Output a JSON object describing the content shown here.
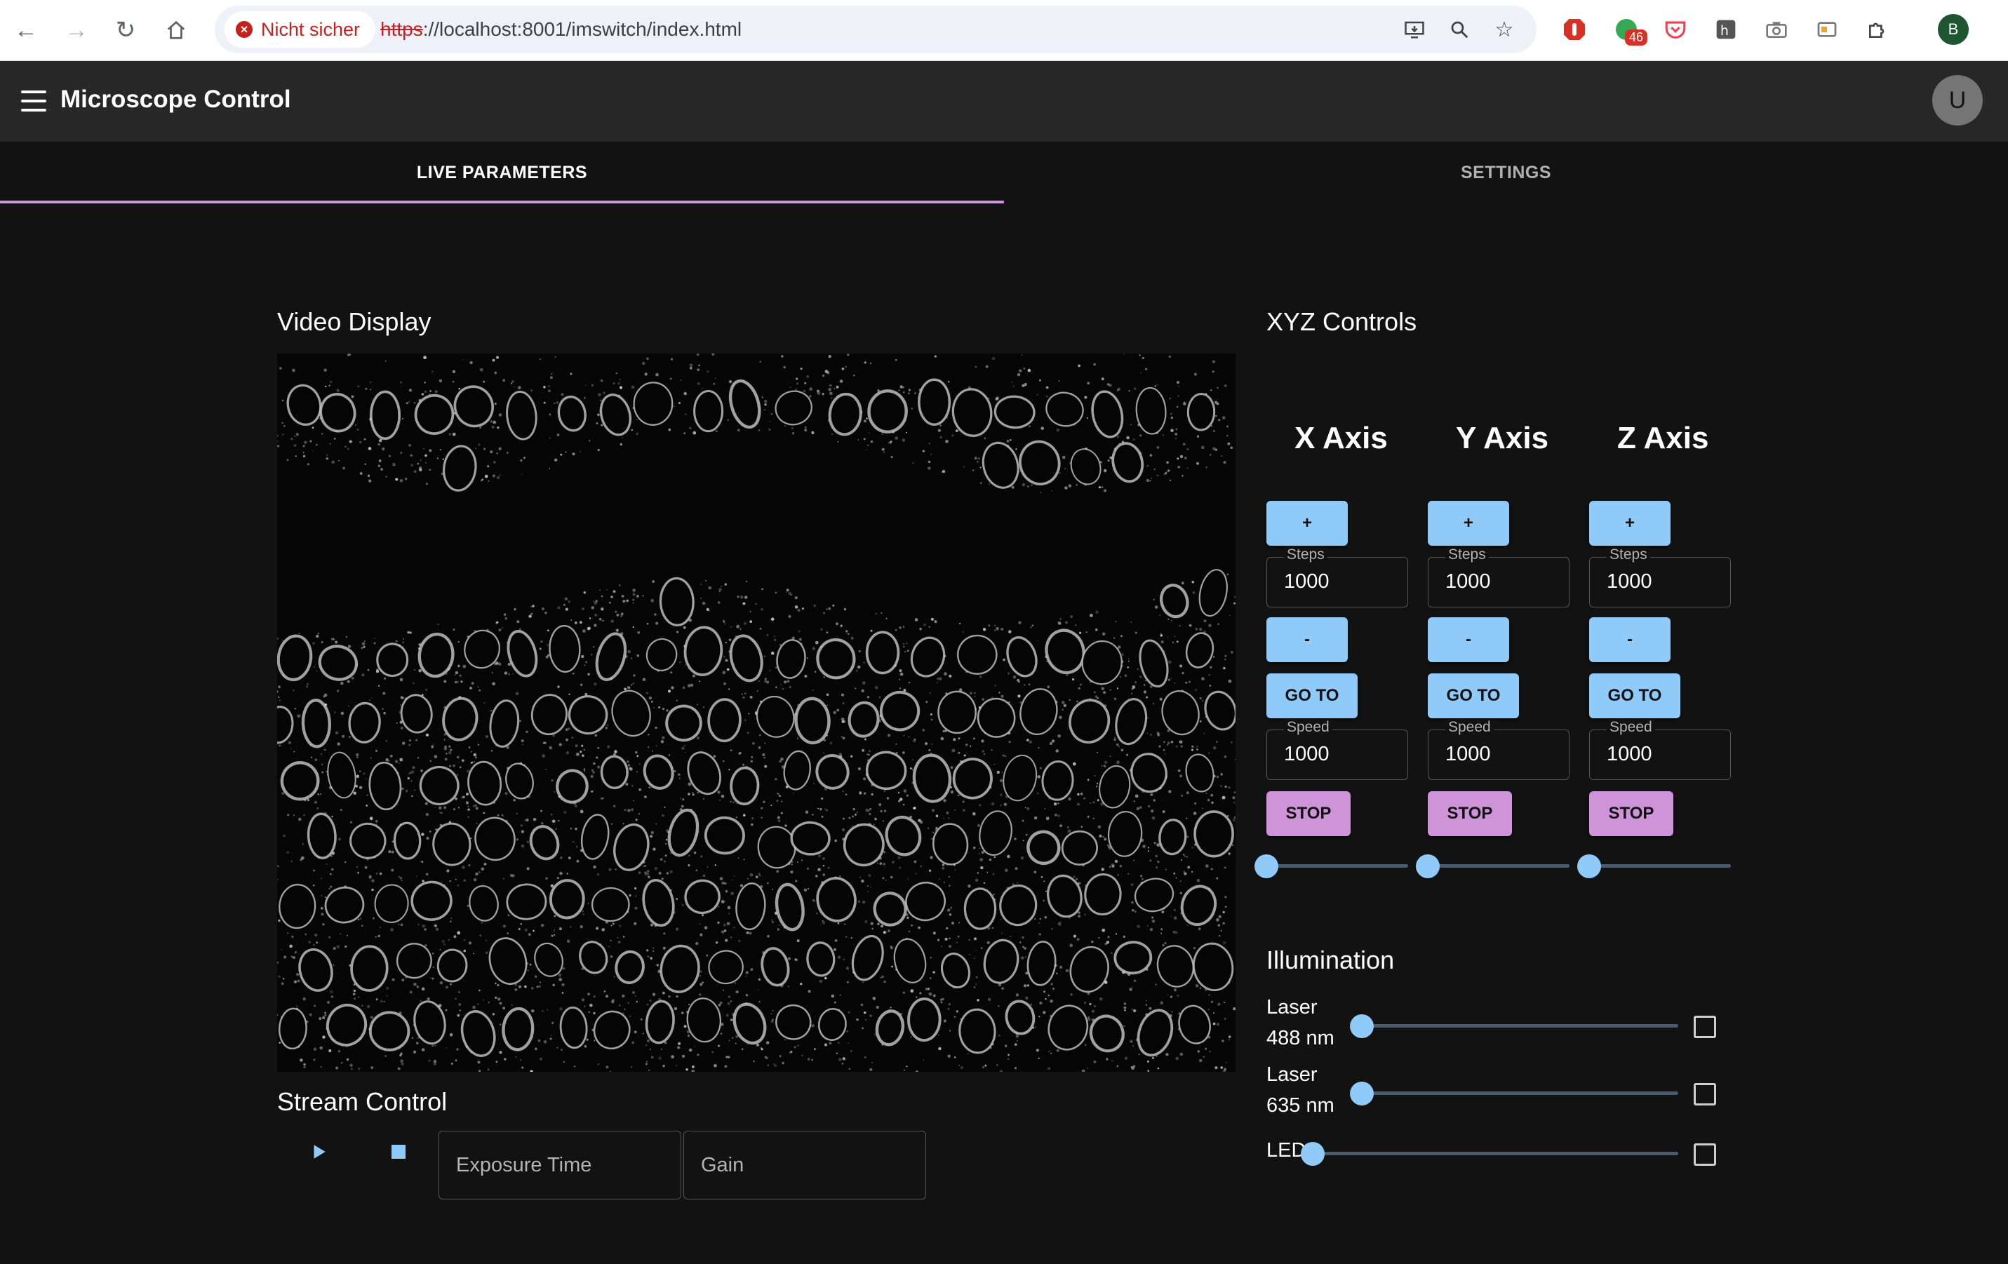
{
  "browser": {
    "security_label": "Nicht sicher",
    "url_protocol": "https",
    "url_rest": "://localhost:8001/imswitch/index.html",
    "extension_badge": "46",
    "profile_initial": "B"
  },
  "appbar": {
    "title": "Microscope Control",
    "avatar_initial": "U"
  },
  "tabs": [
    {
      "label": "LIVE PARAMETERS",
      "active": true
    },
    {
      "label": "SETTINGS",
      "active": false
    }
  ],
  "video": {
    "title": "Video Display"
  },
  "stream": {
    "title": "Stream Control",
    "exposure_placeholder": "Exposure Time",
    "gain_placeholder": "Gain"
  },
  "xyz": {
    "title": "XYZ Controls",
    "axes": [
      {
        "name": "X Axis",
        "plus_label": "+",
        "minus_label": "-",
        "steps_label": "Steps",
        "steps_value": "1000",
        "goto_label": "GO TO",
        "speed_label": "Speed",
        "speed_value": "1000",
        "stop_label": "STOP",
        "slider_value": 0
      },
      {
        "name": "Y Axis",
        "plus_label": "+",
        "minus_label": "-",
        "steps_label": "Steps",
        "steps_value": "1000",
        "goto_label": "GO TO",
        "speed_label": "Speed",
        "speed_value": "1000",
        "stop_label": "STOP",
        "slider_value": 0
      },
      {
        "name": "Z Axis",
        "plus_label": "+",
        "minus_label": "-",
        "steps_label": "Steps",
        "steps_value": "1000",
        "goto_label": "GO TO",
        "speed_label": "Speed",
        "speed_value": "1000",
        "stop_label": "STOP",
        "slider_value": 0
      }
    ]
  },
  "illumination": {
    "title": "Illumination",
    "sources": [
      {
        "label_line1": "Laser",
        "label_line2": "488 nm",
        "value": 0,
        "enabled": false
      },
      {
        "label_line1": "Laser",
        "label_line2": "635 nm",
        "value": 0,
        "enabled": false
      },
      {
        "label_line1": "LED",
        "label_line2": "",
        "value": 0,
        "enabled": false
      }
    ]
  },
  "colors": {
    "primary": "#90caf9",
    "secondary": "#ce93d8",
    "background": "#121212",
    "appbar": "#272727"
  }
}
